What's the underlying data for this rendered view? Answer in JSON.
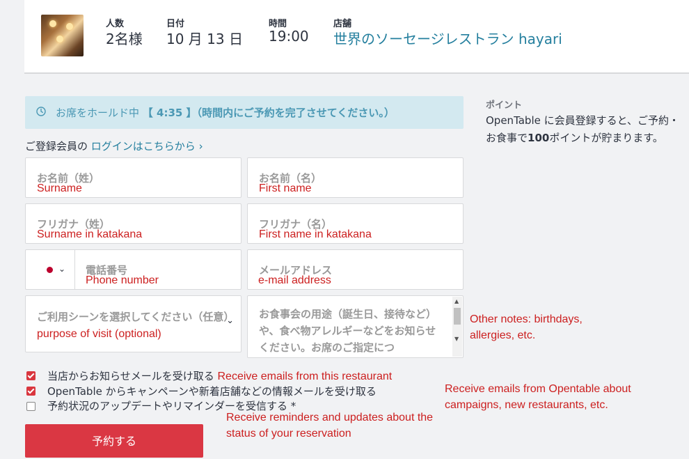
{
  "reservation": {
    "party_label": "人数",
    "party_value": "2名様",
    "date_label": "日付",
    "date_value": "10 月 13 日",
    "time_label": "時間",
    "time_value": "19:00",
    "restaurant_label": "店舗",
    "restaurant_value": "世界のソーセージレストラン hayari"
  },
  "hold": {
    "prefix": "お席をホールド中",
    "timer": "【 4:35 】",
    "suffix": "（時間内にご予約を完了させてください。）"
  },
  "login": {
    "prefix": "ご登録会員の",
    "link": "ログインはこちらから ›"
  },
  "fields": {
    "last_name_label": "お名前（姓）",
    "last_name_note": "Surname",
    "first_name_label": "お名前（名）",
    "first_name_note": "First name",
    "last_kana_label": "フリガナ（姓）",
    "last_kana_note": "Surname in katakana",
    "first_kana_label": "フリガナ（名）",
    "first_kana_note": "First name in katakana",
    "phone_label": "電話番号",
    "phone_note": "Phone number",
    "email_label": "メールアドレス",
    "email_note": "e-mail address",
    "scene_label": "ご利用シーンを選択してください（任意）",
    "scene_note": "purpose of visit (optional)",
    "notes_placeholder": "お食事会の用途（誕生日、接待など）や、食べ物アレルギーなどをお知らせください。お席のご指定につ",
    "notes_note": "Other notes: birthdays, allergies, etc."
  },
  "checkboxes": [
    {
      "label": "当店からお知らせメールを受け取る",
      "checked": true,
      "note": "Receive emails from this restaurant"
    },
    {
      "label": "OpenTable からキャンペーンや新着店舗などの情報メールを受け取る",
      "checked": true,
      "note": "Receive emails from Opentable about campaigns, new restaurants, etc."
    },
    {
      "label": "予約状況のアップデートやリマインダーを受信する *",
      "checked": false,
      "note": "Receive reminders and updates about the status of your reservation"
    }
  ],
  "submit_label": "予約する",
  "points": {
    "title": "ポイント",
    "text_prefix": "OpenTable に会員登録すると、ご予約・お食事で",
    "text_bold": "100",
    "text_suffix": "ポイントが貯まります。"
  },
  "colors": {
    "accent": "#da3743",
    "link": "#247f9e",
    "annotation": "#cc1f1f",
    "hold_bg": "#d3e9f0"
  }
}
